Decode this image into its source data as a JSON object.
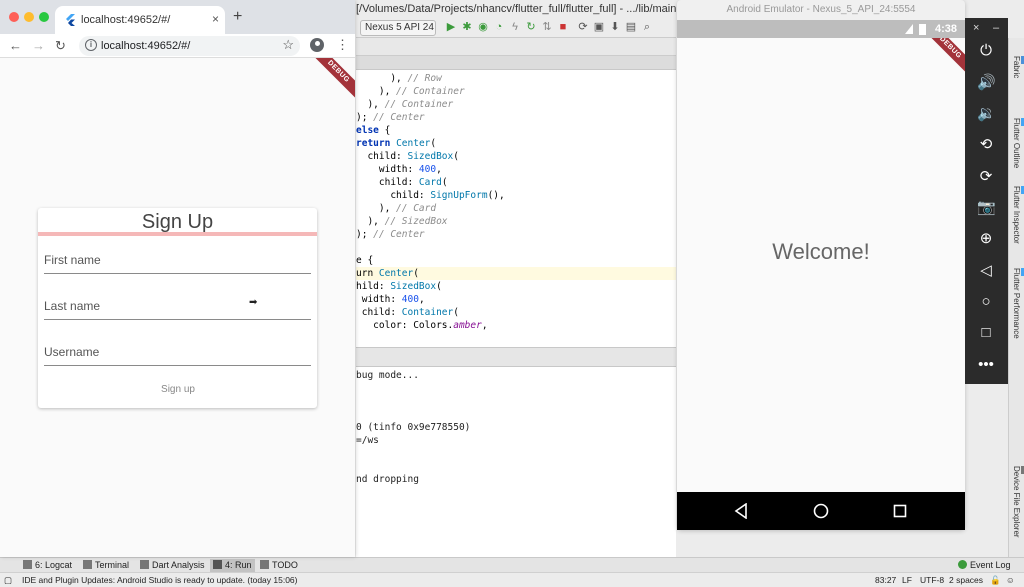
{
  "ide": {
    "title": "[/Volumes/Data/Projects/nhancv/flutter_full/flutter_full] - .../lib/main.dart [fl",
    "device_selector": "Nexus 5 API 24",
    "code_lines": [
      {
        "text": "      ), // Row",
        "kind": "comment"
      },
      {
        "text": "    ), // Container",
        "kind": "comment"
      },
      {
        "text": "  ), // Container",
        "kind": "comment"
      },
      {
        "text": "); // Center",
        "kind": "comment"
      },
      {
        "text": "else {",
        "kind": "kw"
      },
      {
        "text": "return Center(",
        "kind": "mixed1"
      },
      {
        "text": "  child: SizedBox(",
        "kind": "mixed2"
      },
      {
        "text": "    width: 400,",
        "kind": "mixed3"
      },
      {
        "text": "    child: Card(",
        "kind": "mixed2"
      },
      {
        "text": "      child: SignUpForm(),",
        "kind": "mixed2"
      },
      {
        "text": "    ), // Card",
        "kind": "comment"
      },
      {
        "text": "  ), // SizedBox",
        "kind": "comment"
      },
      {
        "text": "); // Center",
        "kind": "comment"
      },
      {
        "text": "",
        "kind": "plain"
      },
      {
        "text": "e {",
        "kind": "plain"
      },
      {
        "text": "urn Center(",
        "kind": "mixed1",
        "highlight": true
      },
      {
        "text": "hild: SizedBox(",
        "kind": "mixed2"
      },
      {
        "text": " width: 400,",
        "kind": "mixed3"
      },
      {
        "text": " child: Container(",
        "kind": "mixed2"
      },
      {
        "text": "   color: Colors.amber,",
        "kind": "plain"
      }
    ],
    "console_lines": [
      "bug mode...",
      "",
      "",
      "",
      "0 (tinfo 0x9e778550)",
      "=/ws",
      "",
      "",
      "nd dropping"
    ],
    "bottom_tabs": [
      {
        "label": "6: Logcat",
        "icon": "logcat-icon"
      },
      {
        "label": "Terminal",
        "icon": "terminal-icon"
      },
      {
        "label": "Dart Analysis",
        "icon": "dart-icon"
      },
      {
        "label": "4: Run",
        "icon": "run-icon",
        "active": true
      },
      {
        "label": "TODO",
        "icon": "todo-icon"
      }
    ],
    "event_log": "Event Log",
    "status_message": "IDE and Plugin Updates: Android Studio is ready to update. (today 15:06)",
    "status_right": [
      "83:27",
      "LF",
      "UTF-8",
      "2 spaces"
    ],
    "right_tabs": [
      "Fabric",
      "Flutter Outline",
      "Flutter Inspector",
      "Flutter Performance",
      "Device File Explorer"
    ]
  },
  "chrome": {
    "tab_title": "localhost:49652/#/",
    "url": "localhost:49652/#/",
    "new_tab": "+",
    "close": "×"
  },
  "app": {
    "debug_banner": "DEBUG",
    "card_title": "Sign Up",
    "progress": 1.0,
    "fields": [
      {
        "label": "First name"
      },
      {
        "label": "Last name"
      },
      {
        "label": "Username"
      }
    ],
    "signup_button": "Sign up"
  },
  "emulator": {
    "title": "Android Emulator - Nexus_5_API_24:5554",
    "time": "4:38",
    "debug_banner": "DEBUG",
    "welcome_text": "Welcome!"
  },
  "colors": {
    "progress": "#f5b8b8",
    "debug_ribbon": "#a3333a"
  }
}
